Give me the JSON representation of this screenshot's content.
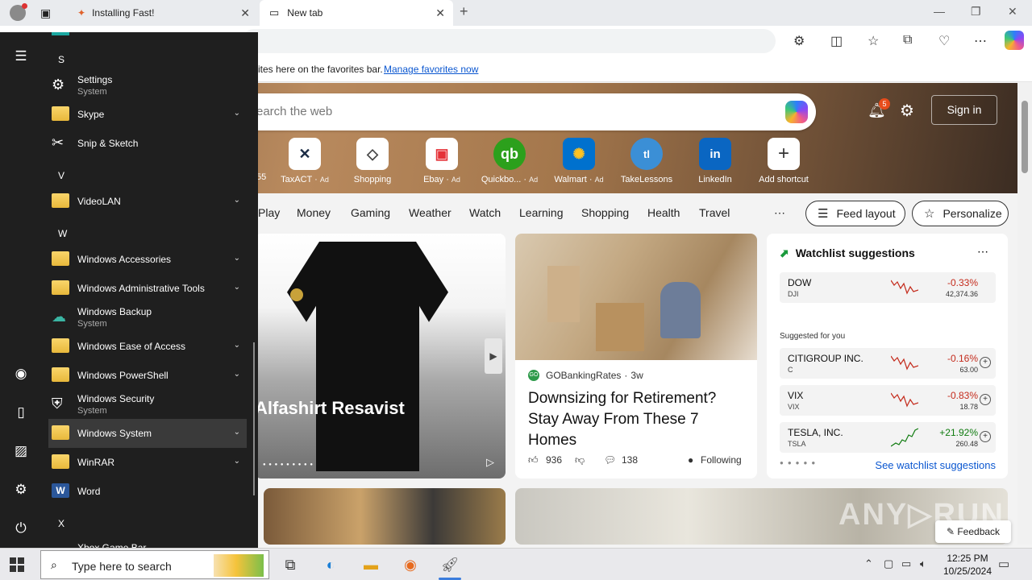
{
  "browser": {
    "tabs": [
      {
        "title": "Installing Fast!",
        "icon": "rocket-favicon"
      },
      {
        "title": "New tab",
        "icon": "page-icon"
      }
    ],
    "favorites_bar": {
      "text": "ites here on the favorites bar.",
      "link": "Manage favorites now"
    }
  },
  "msn": {
    "search_placeholder": "earch the web",
    "notification_count": "5",
    "sign_in": "Sign in",
    "shortcuts": [
      {
        "label": "TaxACT",
        "ad": "Ad",
        "glyph": "✕"
      },
      {
        "label": "Shopping",
        "ad": "",
        "glyph": "◇"
      },
      {
        "label": "Ebay",
        "ad": "Ad",
        "glyph": "▣"
      },
      {
        "label": "Quickbo...",
        "ad": "Ad",
        "glyph": "qb"
      },
      {
        "label": "Walmart",
        "ad": "Ad",
        "glyph": "✺"
      },
      {
        "label": "TakeLessons",
        "ad": "",
        "glyph": "tl"
      },
      {
        "label": "LinkedIn",
        "ad": "",
        "glyph": "in"
      },
      {
        "label": "Add shortcut",
        "ad": "",
        "glyph": "+"
      }
    ],
    "shortcut_fragment": "55",
    "nav": [
      "Play",
      "Money",
      "Gaming",
      "Weather",
      "Watch",
      "Learning",
      "Shopping",
      "Health",
      "Travel"
    ],
    "feed_layout": "Feed layout",
    "personalize": "Personalize",
    "card1_title": "Alfashirt Resavist",
    "card2": {
      "source": "GOBankingRates",
      "age": "3w",
      "headline": "Downsizing for Retirement? Stay Away From These 7 Homes",
      "likes": "936",
      "comments": "138",
      "following": "Following"
    },
    "watchlist": {
      "title": "Watchlist suggestions",
      "suggested_label": "Suggested for you",
      "footer_link": "See watchlist suggestions",
      "items": [
        {
          "name": "DOW",
          "symbol": "DJI",
          "change": "-0.33%",
          "value": "42,374.36",
          "color": "#c42b1c"
        },
        {
          "name": "CITIGROUP INC.",
          "symbol": "C",
          "change": "-0.16%",
          "value": "63.00",
          "color": "#c42b1c"
        },
        {
          "name": "VIX",
          "symbol": "VIX",
          "change": "-0.83%",
          "value": "18.78",
          "color": "#c42b1c"
        },
        {
          "name": "TESLA, INC.",
          "symbol": "TSLA",
          "change": "+21.92%",
          "value": "260.48",
          "color": "#0f7b0f"
        }
      ]
    },
    "feedback": "Feedback",
    "watermark": "ANY.RUN"
  },
  "start_menu": {
    "letters": {
      "s": "S",
      "v": "V",
      "w": "W",
      "x": "X"
    },
    "apps": [
      {
        "name": "Settings",
        "sub": "System",
        "icon": "gear-icon"
      },
      {
        "name": "Skype",
        "folder": true
      },
      {
        "name": "Snip & Sketch",
        "icon": "snip-icon"
      },
      {
        "name": "VideoLAN",
        "folder": true
      },
      {
        "name": "Windows Accessories",
        "folder": true
      },
      {
        "name": "Windows Administrative Tools",
        "folder": true
      },
      {
        "name": "Windows Backup",
        "sub": "System",
        "icon": "backup-icon"
      },
      {
        "name": "Windows Ease of Access",
        "folder": true
      },
      {
        "name": "Windows PowerShell",
        "folder": true
      },
      {
        "name": "Windows Security",
        "sub": "System",
        "icon": "shield-icon"
      },
      {
        "name": "Windows System",
        "folder": true,
        "selected": true
      },
      {
        "name": "WinRAR",
        "folder": true
      },
      {
        "name": "Word",
        "icon": "word-icon"
      },
      {
        "name": "Xbox Game Bar",
        "icon": "xbox-icon"
      }
    ]
  },
  "taskbar": {
    "search_placeholder": "Type here to search",
    "time": "12:25 PM",
    "date": "10/25/2024"
  }
}
